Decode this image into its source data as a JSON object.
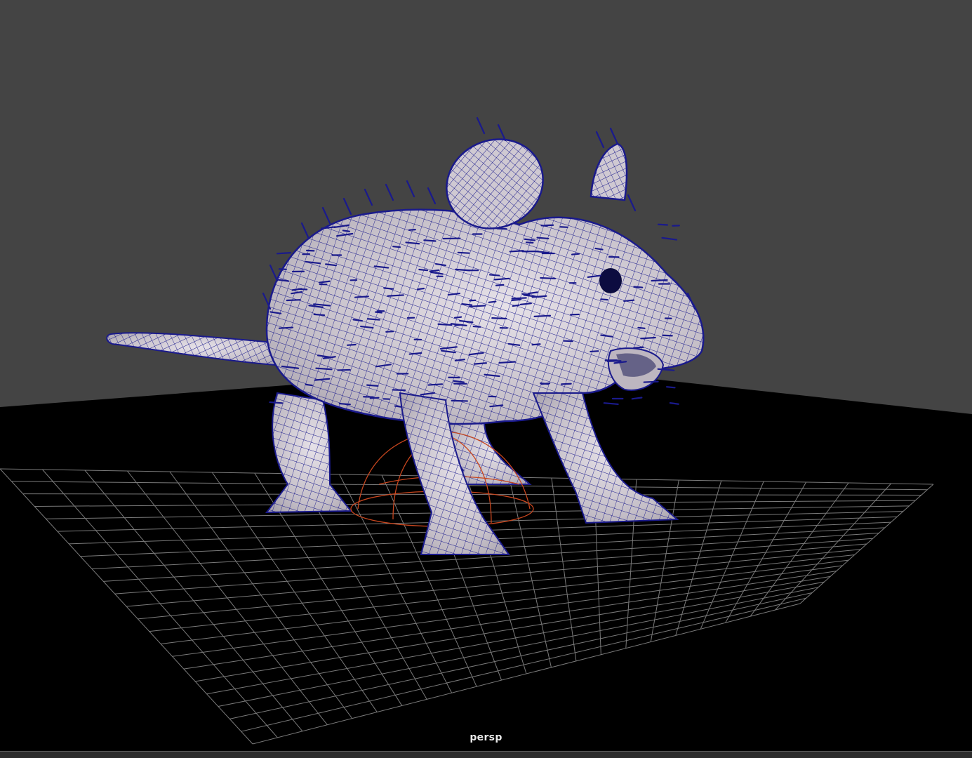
{
  "viewport": {
    "camera_name": "persp",
    "background_color": "#444444",
    "ground_color": "#000000",
    "grid_color": "#7a7a7a",
    "mesh_fill_color": "#c9c3cb",
    "wireframe_color": "#1a1a8c",
    "rig_color": "#c8461e"
  }
}
